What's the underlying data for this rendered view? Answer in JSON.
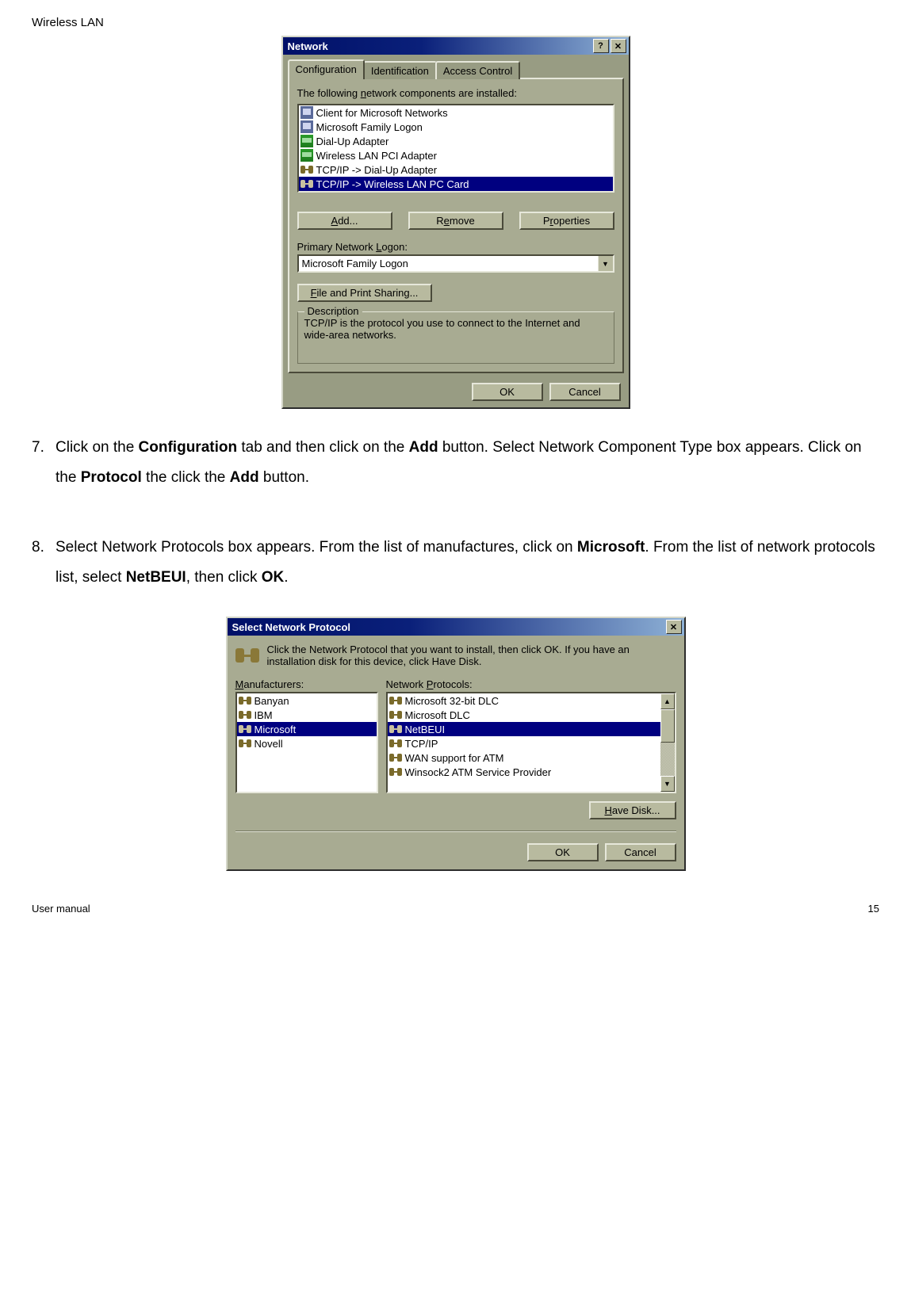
{
  "page": {
    "header": "Wireless LAN",
    "footer_left": "User manual",
    "footer_right": "15"
  },
  "step7": {
    "num": "7.",
    "p1": "Click on the ",
    "b1": "Configuration",
    "p2": " tab and then click on the ",
    "b2": "Add",
    "p3": " button. Select Network Component Type box appears. Click on the ",
    "b3": "Protocol",
    "p4": " the click the ",
    "b4": "Add",
    "p5": " button."
  },
  "step8": {
    "num": "8.",
    "p1": "Select Network Protocols box appears. From the list of manufactures, click on ",
    "b1": "Microsoft",
    "p2": ". From the list of network protocols list, select ",
    "b2": "NetBEUI",
    "p3": ", then click ",
    "b3": "OK",
    "p4": "."
  },
  "dlg1": {
    "title": "Network",
    "help_glyph": "?",
    "close_glyph": "✕",
    "tabs": {
      "t1": "Configuration",
      "t2": "Identification",
      "t3": "Access Control"
    },
    "components_label": "The following network components are installed:",
    "items": [
      "Client for Microsoft Networks",
      "Microsoft Family Logon",
      "Dial-Up Adapter",
      "Wireless LAN PCI Adapter",
      "TCP/IP -> Dial-Up Adapter",
      "TCP/IP -> Wireless LAN PC Card"
    ],
    "add_btn": "Add...",
    "remove_btn": "Remove",
    "prop_btn": "Properties",
    "prim_label": "Primary Network Logon:",
    "prim_value": "Microsoft Family Logon",
    "fps_btn": "File and Print Sharing...",
    "desc_legend": "Description",
    "desc_text": "TCP/IP is the protocol you use to connect to the Internet and wide-area networks.",
    "ok": "OK",
    "cancel": "Cancel"
  },
  "dlg2": {
    "title": "Select Network Protocol",
    "close_glyph": "✕",
    "intro": "Click the Network Protocol that you want to install, then click OK. If you have an installation disk for this device, click Have Disk.",
    "manu_label": "Manufacturers:",
    "proto_label": "Network Protocols:",
    "manufacturers": [
      "Banyan",
      "IBM",
      "Microsoft",
      "Novell"
    ],
    "protocols": [
      "Microsoft 32-bit DLC",
      "Microsoft DLC",
      "NetBEUI",
      "TCP/IP",
      "WAN support for ATM",
      "Winsock2 ATM Service Provider"
    ],
    "have_disk": "Have Disk...",
    "ok": "OK",
    "cancel": "Cancel"
  }
}
